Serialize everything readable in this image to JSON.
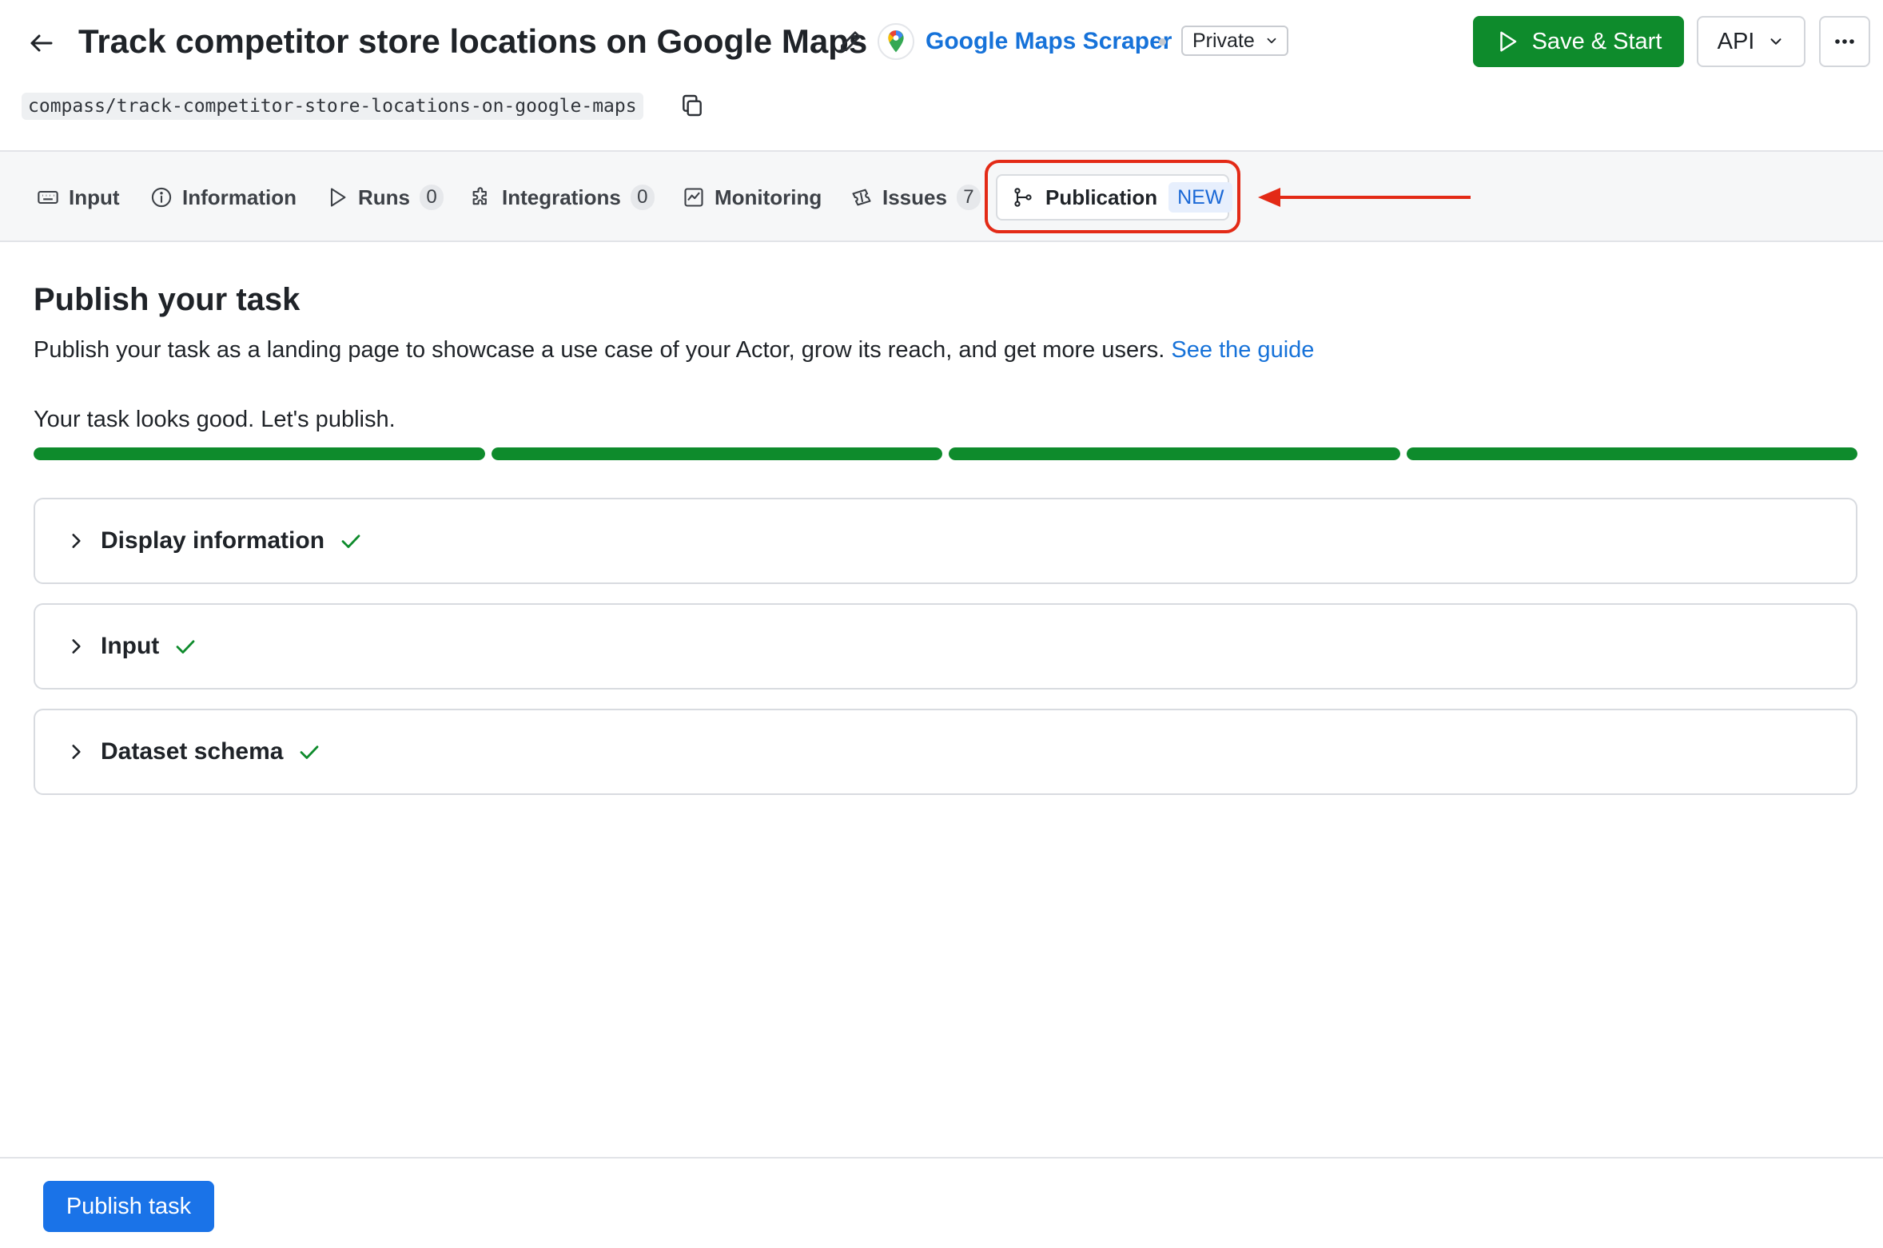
{
  "header": {
    "title": "Track competitor store locations on Google Maps",
    "actor_name": "Google Maps Scraper",
    "privacy": "Private",
    "save_start_label": "Save & Start",
    "api_label": "API",
    "slug": "compass/track-competitor-store-locations-on-google-maps"
  },
  "tabs": [
    {
      "label": "Input",
      "icon": "keyboard-icon"
    },
    {
      "label": "Information",
      "icon": "info-icon"
    },
    {
      "label": "Runs",
      "count": "0",
      "icon": "play-icon"
    },
    {
      "label": "Integrations",
      "count": "0",
      "icon": "puzzle-icon"
    },
    {
      "label": "Monitoring",
      "icon": "chart-icon"
    },
    {
      "label": "Issues",
      "count": "7",
      "icon": "ticket-icon"
    },
    {
      "label": "Publication",
      "badge": "NEW",
      "icon": "branch-icon",
      "active": true
    }
  ],
  "main": {
    "heading": "Publish your task",
    "description": "Publish your task as a landing page to showcase a use case of your Actor, grow its reach, and get more users.",
    "guide_link": "See the guide",
    "status": "Your task looks good. Let's publish.",
    "progress_steps": [
      1,
      1,
      1,
      1
    ],
    "sections": [
      {
        "title": "Display information",
        "complete": true
      },
      {
        "title": "Input",
        "complete": true
      },
      {
        "title": "Dataset schema",
        "complete": true
      }
    ]
  },
  "footer": {
    "publish_label": "Publish task"
  },
  "colors": {
    "primary_green": "#0e8b2c",
    "link_blue": "#1672d9",
    "button_blue": "#1a73e8",
    "annotation_red": "#e32a16",
    "badge_bg": "#e7effd"
  }
}
